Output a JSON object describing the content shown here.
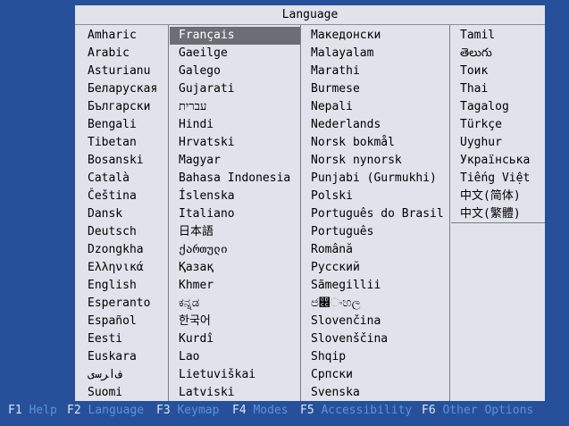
{
  "dialog": {
    "title": "Language",
    "selected": "Français",
    "columns": [
      [
        "Amharic",
        "Arabic",
        "Asturianu",
        "Беларуская",
        "Български",
        "Bengali",
        "Tibetan",
        "Bosanski",
        "Català",
        "Čeština",
        "Dansk",
        "Deutsch",
        "Dzongkha",
        "Ελληνικά",
        "English",
        "Esperanto",
        "Español",
        "Eesti",
        "Euskara",
        "ﻑﺍﺮﺳی",
        "Suomi"
      ],
      [
        "Français",
        "Gaeilge",
        "Galego",
        "Gujarati",
        "עברית",
        "Hindi",
        "Hrvatski",
        "Magyar",
        "Bahasa Indonesia",
        "Íslenska",
        "Italiano",
        "日本語",
        "ქართული",
        "Қазақ",
        "Khmer",
        "ಕನ್ನಡ",
        "한국어",
        "Kurdî",
        "Lao",
        "Lietuviškai",
        "Latviski"
      ],
      [
        "Македонски",
        "Malayalam",
        "Marathi",
        "Burmese",
        "Nepali",
        "Nederlands",
        "Norsk bokmål",
        "Norsk nynorsk",
        "Punjabi (Gurmukhi)",
        "Polski",
        "Português do Brasil",
        "Português",
        "Română",
        "Русский",
        "Sãmegillii",
        "ජ෌ංහල",
        "Slovenčina",
        "Slovenščina",
        "Shqip",
        "Српски",
        "Svenska"
      ],
      [
        "Tamil",
        "తెలుగు",
        "Тоик",
        "Thai",
        "Tagalog",
        "Türkçe",
        "Uyghur",
        "Українська",
        "Tiếng Việt",
        "中文(简体)",
        "中文(繁體)"
      ]
    ]
  },
  "footer": [
    {
      "key": "F1",
      "label": "Help"
    },
    {
      "key": "F2",
      "label": "Language"
    },
    {
      "key": "F3",
      "label": "Keymap"
    },
    {
      "key": "F4",
      "label": "Modes"
    },
    {
      "key": "F5",
      "label": "Accessibility"
    },
    {
      "key": "F6",
      "label": "Other Options"
    }
  ],
  "colors": {
    "background": "#26509a",
    "dialog": "#e0e3ea",
    "selection": "#6b6e74",
    "footer_text": "#5d93d8"
  }
}
